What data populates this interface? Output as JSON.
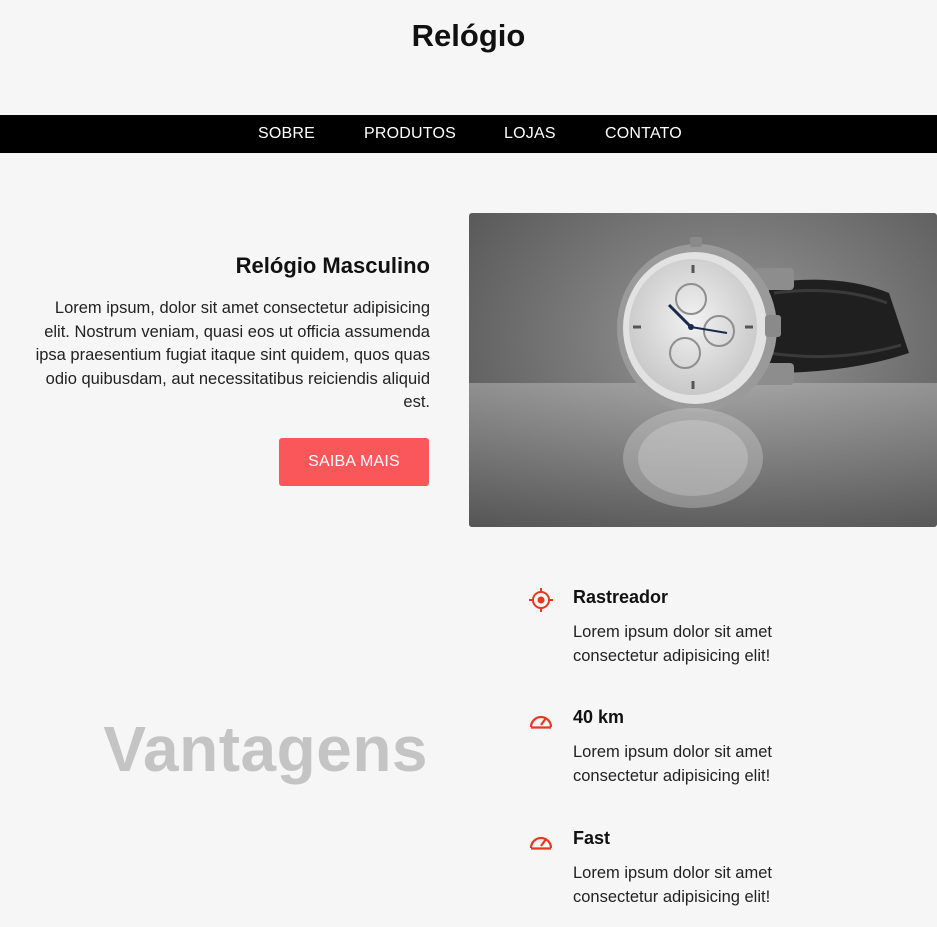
{
  "header": {
    "title": "Relógio"
  },
  "nav": {
    "items": [
      {
        "label": "SOBRE"
      },
      {
        "label": "PRODUTOS"
      },
      {
        "label": "LOJAS"
      },
      {
        "label": "CONTATO"
      }
    ]
  },
  "hero": {
    "title": "Relógio Masculino",
    "description": "Lorem ipsum, dolor sit amet consectetur adipisicing elit. Nostrum veniam, quasi eos ut officia assumenda ipsa praesentium fugiat itaque sint quidem, quos quas odio quibusdam, aut necessitatibus reiciendis aliquid est.",
    "button_label": "SAIBA MAIS",
    "image_icon": "watch-photo"
  },
  "advantages": {
    "heading": "Vantagens",
    "items": [
      {
        "icon": "crosshair-icon",
        "title": "Rastreador",
        "description": "Lorem ipsum dolor sit amet consectetur adipisicing elit!"
      },
      {
        "icon": "speedometer-icon",
        "title": "40 km",
        "description": "Lorem ipsum dolor sit amet consectetur adipisicing elit!"
      },
      {
        "icon": "speedometer-icon",
        "title": "Fast",
        "description": "Lorem ipsum dolor sit amet consectetur adipisicing elit!"
      }
    ]
  },
  "colors": {
    "background": "#f6f6f6",
    "nav_background": "#000000",
    "accent": "#f95759",
    "icon": "#e8381e",
    "heading_muted": "#c4c4c4"
  }
}
